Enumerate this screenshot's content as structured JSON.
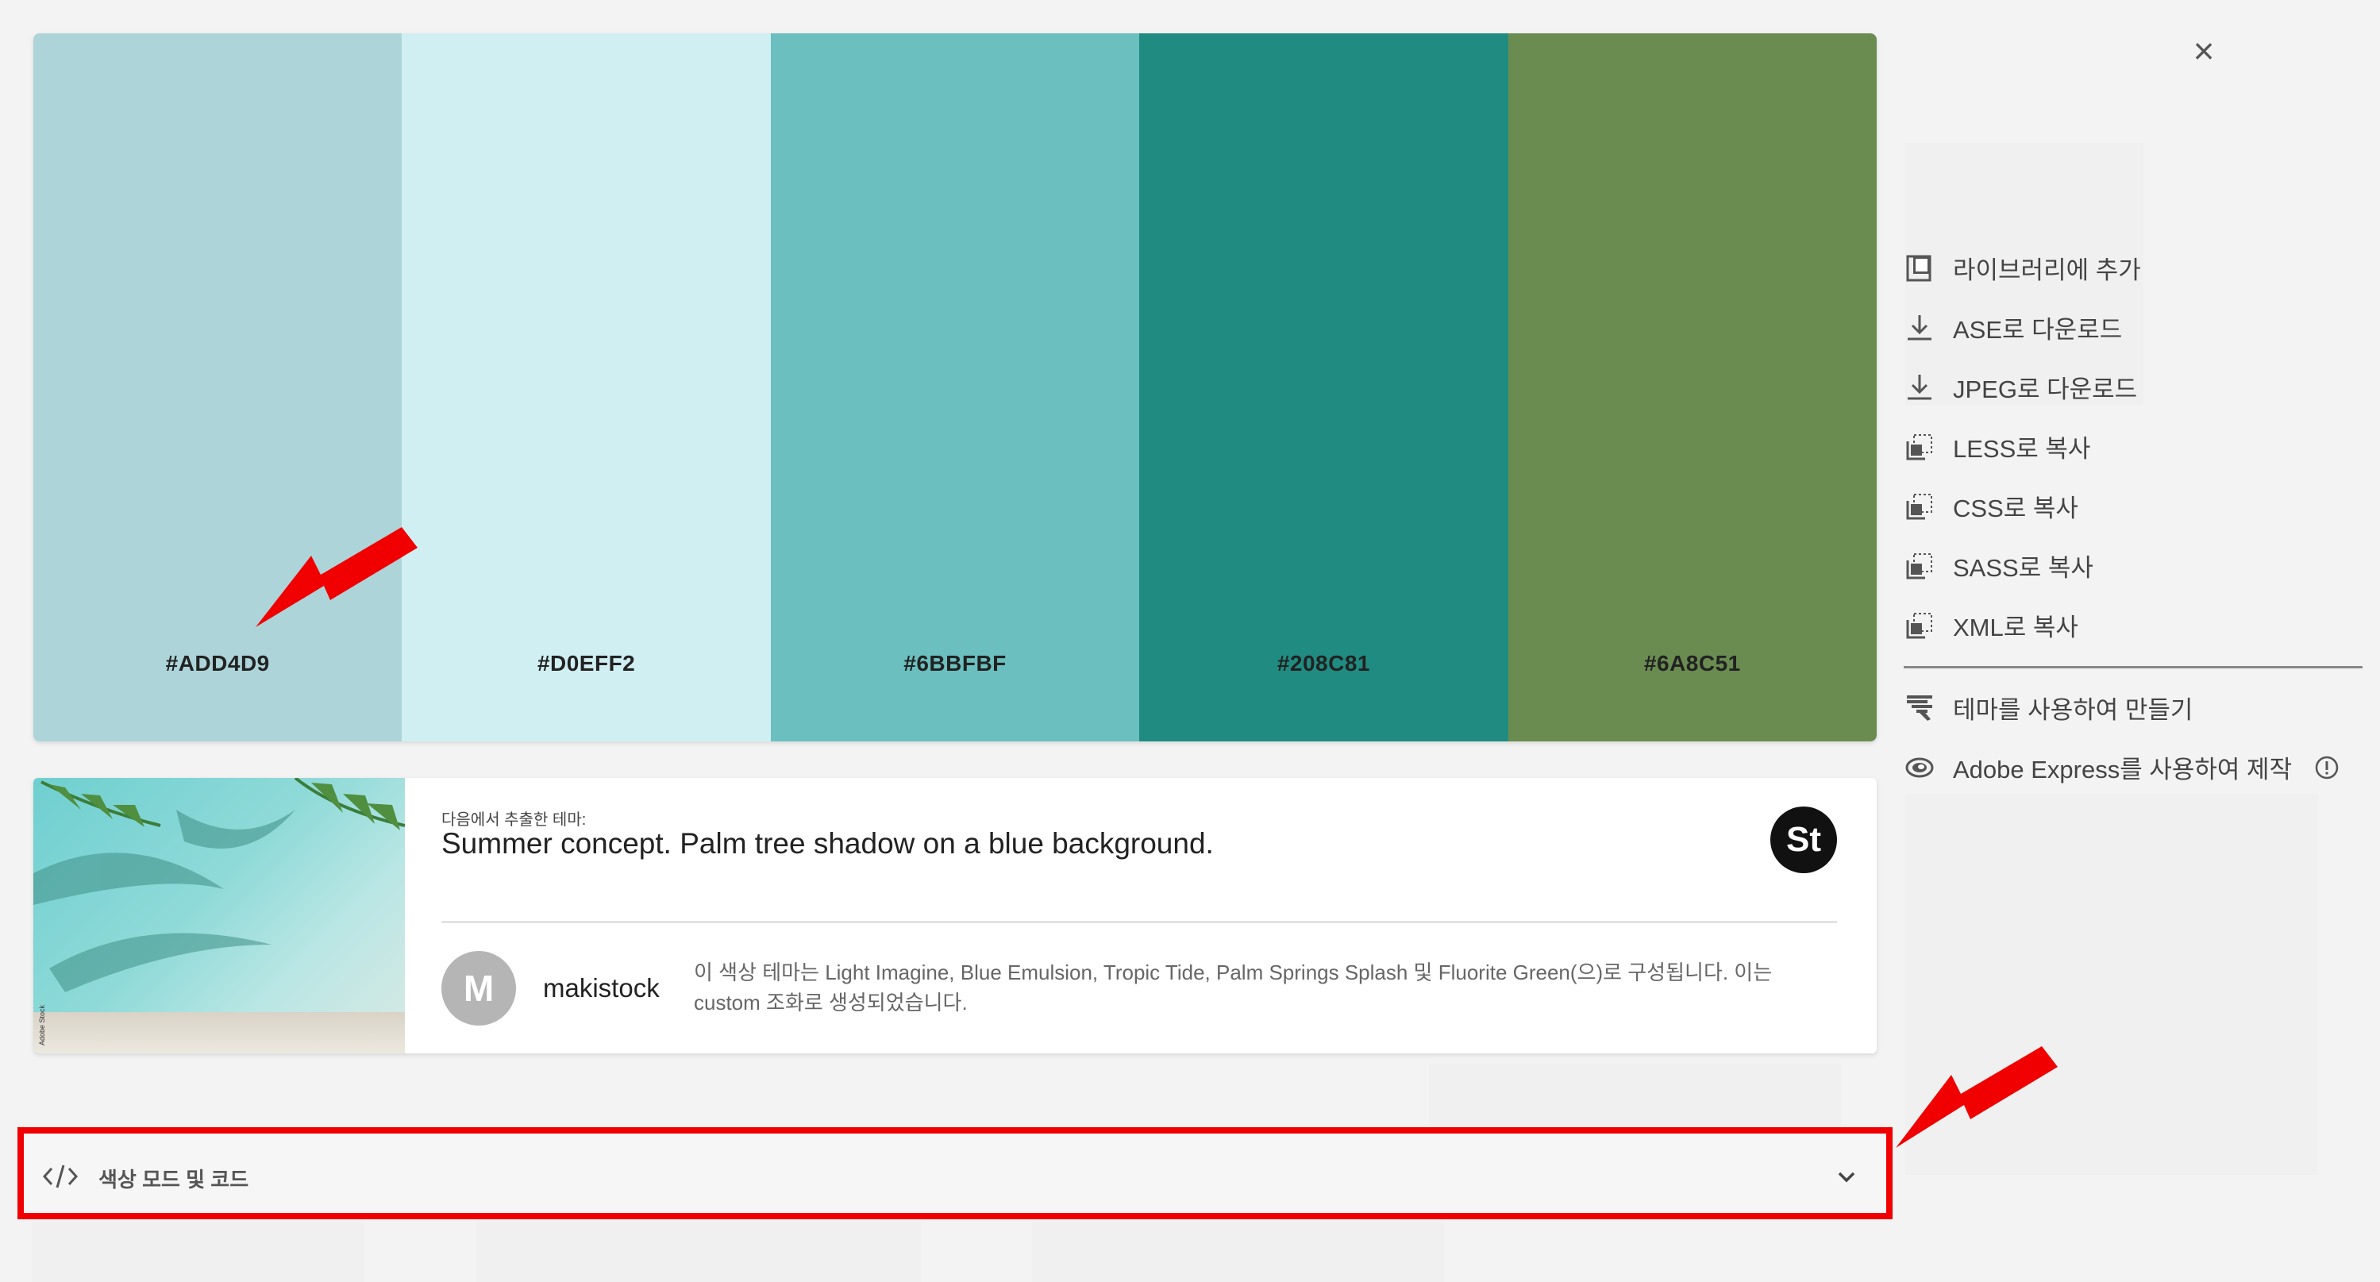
{
  "palette": [
    {
      "hex_label": "#ADD4D9",
      "color": "#ADD4D9"
    },
    {
      "hex_label": "#D0EFF2",
      "color": "#D0EFF2"
    },
    {
      "hex_label": "#6BBFBF",
      "color": "#6BBFBF"
    },
    {
      "hex_label": "#208C81",
      "color": "#208C81"
    },
    {
      "hex_label": "#6A8C51",
      "color": "#6A8C51"
    }
  ],
  "actions": {
    "add_to_library": "라이브러리에 추가",
    "download_ase": "ASE로 다운로드",
    "download_jpeg": "JPEG로 다운로드",
    "copy_less": "LESS로 복사",
    "copy_css": "CSS로 복사",
    "copy_sass": "SASS로 복사",
    "copy_xml": "XML로 복사",
    "create_with_theme": "테마를 사용하여 만들기",
    "create_with_express": "Adobe Express를 사용하여 제작"
  },
  "theme": {
    "extracted_label": "다음에서 추출한 테마:",
    "title": "Summer concept. Palm tree shadow on a blue background.",
    "source_badge": "St",
    "avatar_initial": "M",
    "author": "makistock",
    "description": "이 색상 테마는 Light Imagine, Blue Emulsion, Tropic Tide, Palm Springs Splash 및 Fluorite Green(으)로 구성됩니다. 이는 custom 조화로 생성되었습니다.",
    "thumb_credit": "Adobe Stock"
  },
  "accordion": {
    "label": "색상 모드 및 코드"
  },
  "close_symbol": "×",
  "annotation_color": "#f00000"
}
